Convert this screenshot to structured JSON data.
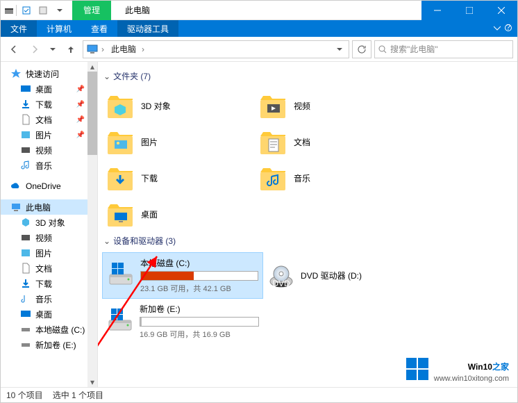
{
  "title": "此电脑",
  "context_tab": "管理",
  "ribbon": {
    "file": "文件",
    "tabs": [
      "计算机",
      "查看",
      "驱动器工具"
    ]
  },
  "address": {
    "root": "此电脑"
  },
  "search": {
    "placeholder": "搜索\"此电脑\""
  },
  "sidebar": {
    "quick": {
      "label": "快速访问",
      "items": [
        {
          "label": "桌面",
          "pinned": true
        },
        {
          "label": "下载",
          "pinned": true
        },
        {
          "label": "文档",
          "pinned": true
        },
        {
          "label": "图片",
          "pinned": true
        },
        {
          "label": "视频"
        },
        {
          "label": "音乐"
        }
      ]
    },
    "onedrive": "OneDrive",
    "thispc": {
      "label": "此电脑",
      "items": [
        {
          "label": "3D 对象"
        },
        {
          "label": "视频"
        },
        {
          "label": "图片"
        },
        {
          "label": "文档"
        },
        {
          "label": "下载"
        },
        {
          "label": "音乐"
        },
        {
          "label": "桌面"
        },
        {
          "label": "本地磁盘 (C:)"
        },
        {
          "label": "新加卷 (E:)"
        }
      ]
    }
  },
  "groups": {
    "folders": {
      "label": "文件夹 (7)",
      "items": [
        "3D 对象",
        "视频",
        "图片",
        "文档",
        "下载",
        "音乐",
        "桌面"
      ]
    },
    "drives": {
      "label": "设备和驱动器 (3)",
      "items": [
        {
          "name": "本地磁盘 (C:)",
          "sub": "23.1 GB 可用，共 42.1 GB",
          "fill": 45,
          "selected": true,
          "type": "hdd"
        },
        {
          "name": "DVD 驱动器 (D:)",
          "type": "dvd"
        },
        {
          "name": "新加卷 (E:)",
          "sub": "16.9 GB 可用，共 16.9 GB",
          "fill": 1,
          "type": "hdd"
        }
      ]
    }
  },
  "status": {
    "count": "10 个项目",
    "selected": "选中 1 个项目"
  },
  "watermark": {
    "brand_a": "Win10",
    "brand_b": "之家",
    "url": "www.win10xitong.com"
  }
}
